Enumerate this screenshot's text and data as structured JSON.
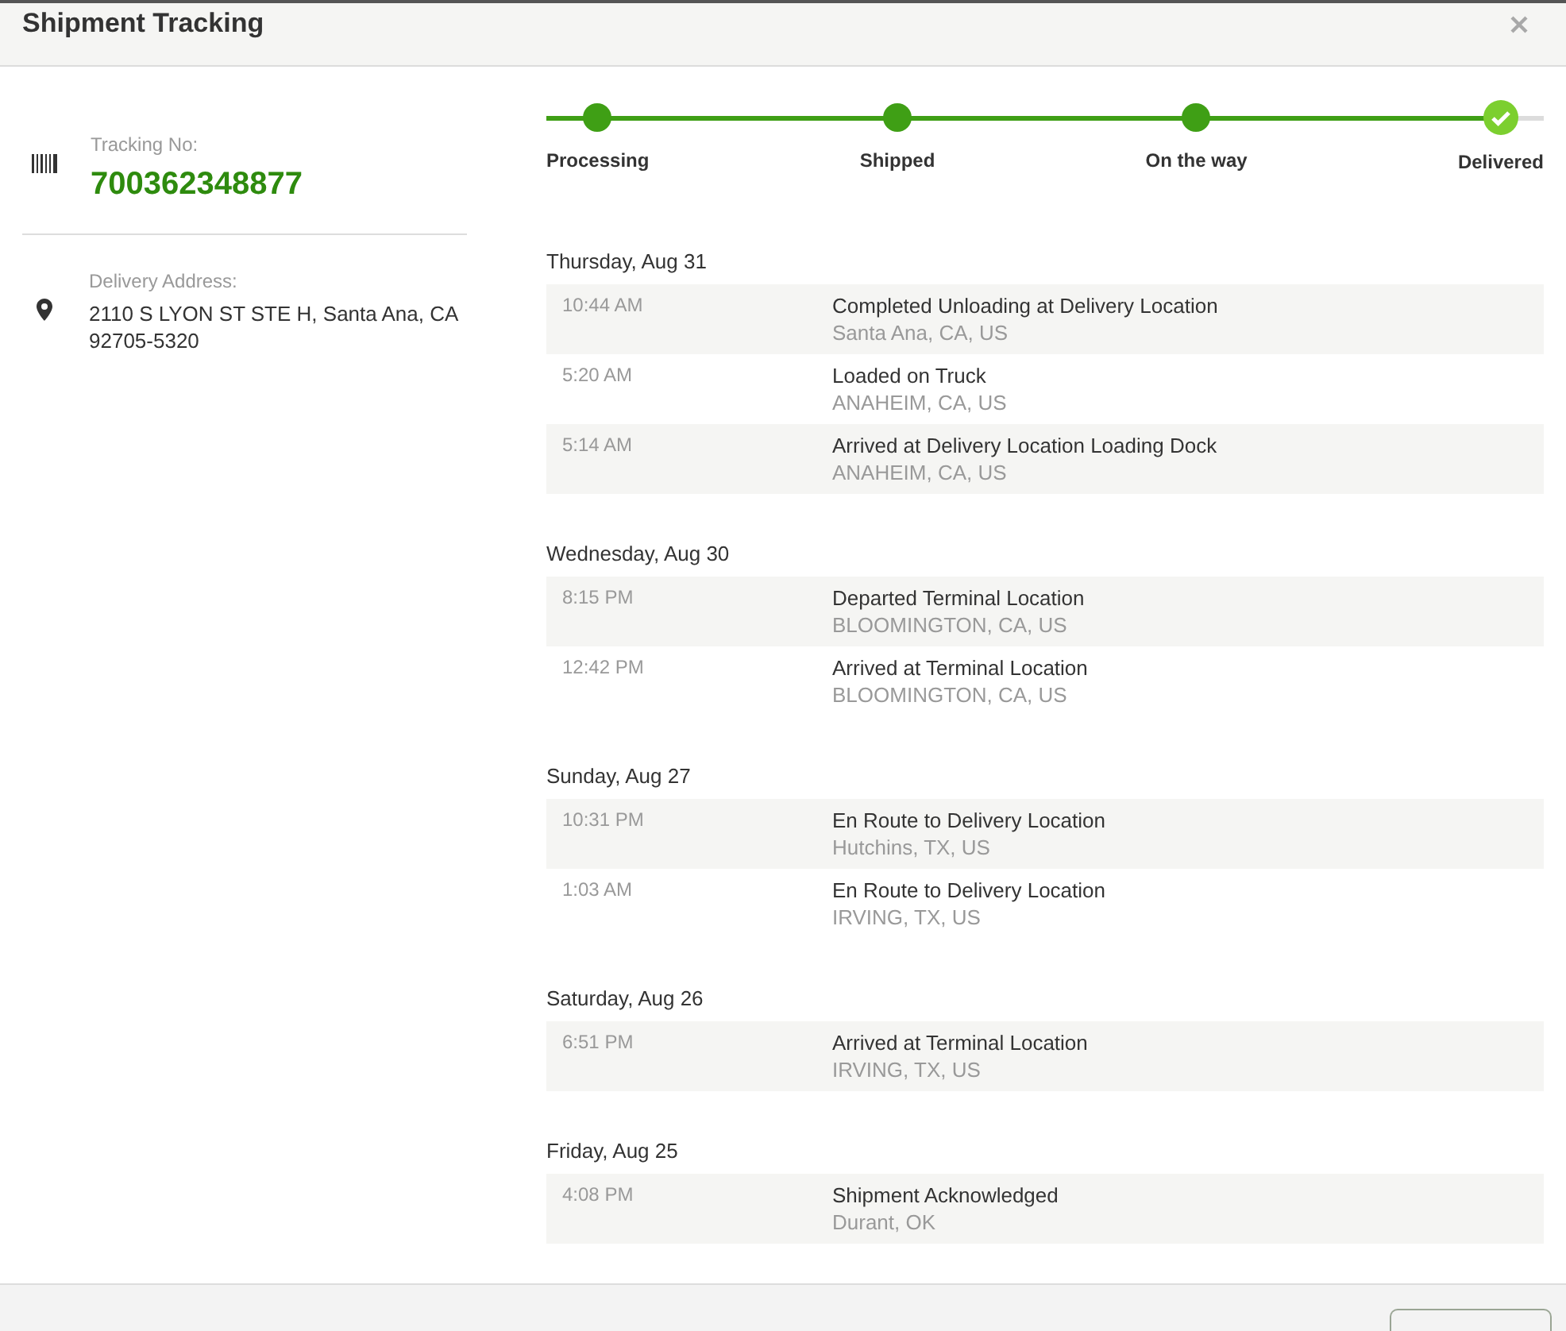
{
  "window": {
    "title": "Shipment Tracking"
  },
  "tracking": {
    "label": "Tracking No:",
    "number": "700362348877"
  },
  "address": {
    "label": "Delivery Address:",
    "lines": [
      "2110 S LYON ST STE H, Santa Ana, CA",
      "92705-5320"
    ]
  },
  "progress": {
    "level": 0.954,
    "steps": [
      {
        "label": "Processing",
        "done": true
      },
      {
        "label": "Shipped",
        "done": true
      },
      {
        "label": "On the way",
        "done": true
      },
      {
        "label": "Delivered",
        "current": true
      }
    ]
  },
  "days": [
    {
      "date": "Thursday, Aug 31",
      "events": [
        {
          "time": "10:44 AM",
          "status": "Completed Unloading at Delivery Location",
          "location": "Santa Ana, CA, US"
        },
        {
          "time": "5:20 AM",
          "status": "Loaded on Truck",
          "location": "ANAHEIM, CA, US"
        },
        {
          "time": "5:14 AM",
          "status": "Arrived at Delivery Location Loading Dock",
          "location": "ANAHEIM, CA, US"
        }
      ]
    },
    {
      "date": "Wednesday, Aug 30",
      "events": [
        {
          "time": "8:15 PM",
          "status": "Departed Terminal Location",
          "location": "BLOOMINGTON, CA, US"
        },
        {
          "time": "12:42 PM",
          "status": "Arrived at Terminal Location",
          "location": "BLOOMINGTON, CA, US"
        }
      ]
    },
    {
      "date": "Sunday, Aug 27",
      "events": [
        {
          "time": "10:31 PM",
          "status": "En Route to Delivery Location",
          "location": "Hutchins, TX, US"
        },
        {
          "time": "1:03 AM",
          "status": "En Route to Delivery Location",
          "location": "IRVING, TX, US"
        }
      ]
    },
    {
      "date": "Saturday, Aug 26",
      "events": [
        {
          "time": "6:51 PM",
          "status": "Arrived at Terminal Location",
          "location": "IRVING, TX, US"
        }
      ]
    },
    {
      "date": "Friday, Aug 25",
      "events": [
        {
          "time": "4:08 PM",
          "status": "Shipment Acknowledged",
          "location": "Durant, OK"
        }
      ]
    }
  ]
}
